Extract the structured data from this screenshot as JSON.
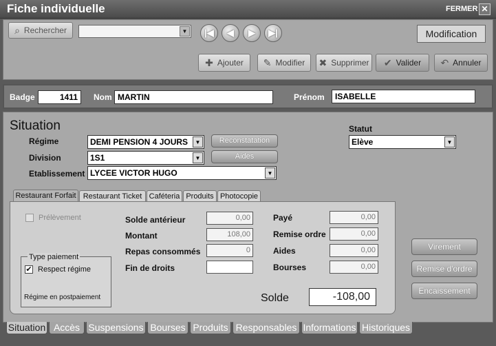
{
  "window": {
    "title": "Fiche individuelle",
    "close_label": "FERMER",
    "close_glyph": "✕"
  },
  "toolbar": {
    "search_label": "Rechercher",
    "search_value": "",
    "mode": "Modification",
    "add_label": "Ajouter",
    "edit_label": "Modifier",
    "delete_label": "Supprimer",
    "validate_label": "Valider",
    "cancel_label": "Annuler"
  },
  "identity": {
    "badge_label": "Badge",
    "badge_value": "1411",
    "nom_label": "Nom",
    "nom_value": "MARTIN",
    "prenom_label": "Prénom",
    "prenom_value": "ISABELLE"
  },
  "situation": {
    "title": "Situation",
    "regime_label": "Régime",
    "regime_value": "DEMI PENSION 4 JOURS",
    "division_label": "Division",
    "division_value": "1S1",
    "etab_label": "Etablissement",
    "etab_value": "LYCEE VICTOR HUGO",
    "reconstatation_label": "Reconstatation",
    "aides_button_label": "Aides",
    "statut_label": "Statut",
    "statut_value": "Elève"
  },
  "tabs": [
    "Restaurant Forfait",
    "Restaurant Ticket",
    "Caféteria",
    "Produits",
    "Photocopie"
  ],
  "forfait": {
    "prelevement_label": "Prélèvement",
    "solde_anterieur_label": "Solde antérieur",
    "solde_anterieur": "0,00",
    "montant_label": "Montant",
    "montant": "108,00",
    "repas_label": "Repas consommés",
    "repas": "0",
    "fin_droits_label": "Fin de droits",
    "fin_droits": "",
    "paye_label": "Payé",
    "paye": "0,00",
    "remise_ordre_label": "Remise ordre",
    "remise_ordre": "0,00",
    "aides_label": "Aides",
    "aides": "0,00",
    "bourses_label": "Bourses",
    "bourses": "0,00",
    "type_paiement_label": "Type paiement",
    "respect_regime_label": "Respect régime",
    "postpaiement_label": "Régime en postpaiement",
    "solde_label": "Solde",
    "solde": "-108,00"
  },
  "side_buttons": {
    "virement": "Virement",
    "remise_ordre": "Remise d'ordre",
    "encaissement": "Encaissement"
  },
  "bottom_tabs": [
    "Situation",
    "Accès",
    "Suspensions",
    "Bourses",
    "Produits",
    "Responsables",
    "Informations",
    "Historiques"
  ]
}
